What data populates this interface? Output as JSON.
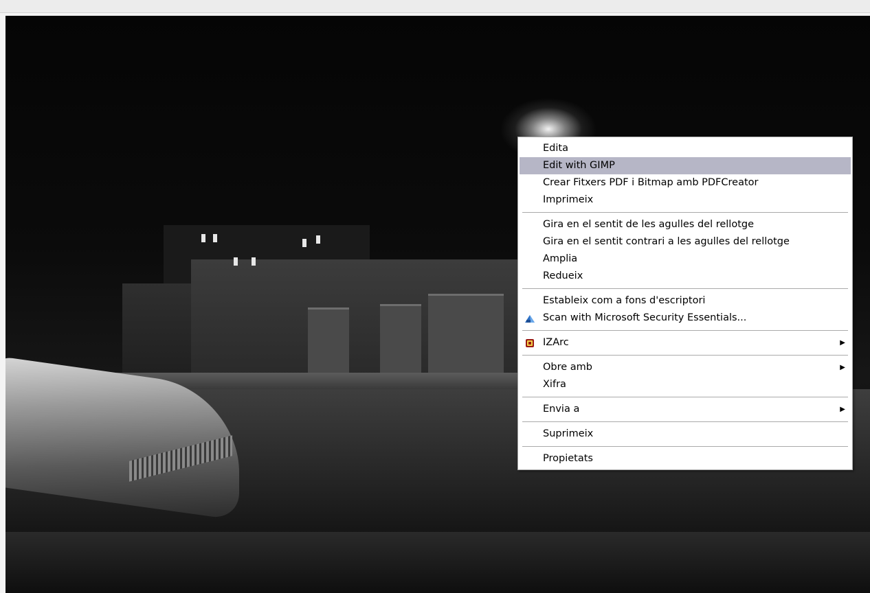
{
  "menu": {
    "items": [
      {
        "label": "Edita"
      },
      {
        "label": "Edit with GIMP",
        "highlighted": true
      },
      {
        "label": "Crear Fitxers PDF i Bitmap amb PDFCreator"
      },
      {
        "label": "Imprimeix"
      },
      {
        "label": "Gira en el sentit de les agulles del rellotge"
      },
      {
        "label": "Gira en el sentit contrari a les agulles del rellotge"
      },
      {
        "label": "Amplia"
      },
      {
        "label": "Redueix"
      },
      {
        "label": "Estableix com a fons d'escriptori"
      },
      {
        "label": "Scan with Microsoft Security Essentials...",
        "icon": "security-essentials-icon"
      },
      {
        "label": "IZArc",
        "icon": "izarc-icon",
        "submenu": true
      },
      {
        "label": "Obre amb",
        "submenu": true
      },
      {
        "label": "Xifra"
      },
      {
        "label": "Envia a",
        "submenu": true
      },
      {
        "label": "Suprimeix"
      },
      {
        "label": "Propietats"
      }
    ],
    "submenu_arrow": "▶"
  },
  "colors": {
    "highlight": "#b6b6c6",
    "menu_bg": "#ffffff",
    "separator": "#a9a9a9"
  }
}
